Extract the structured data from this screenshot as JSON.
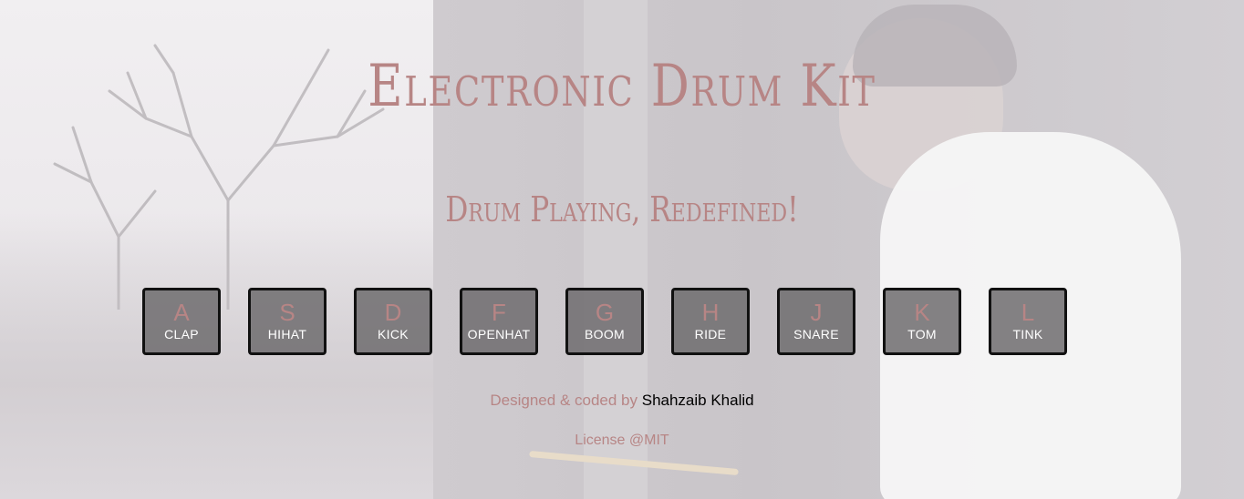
{
  "header": {
    "title": "Electronic Drum Kit",
    "subtitle": "Drum Playing, Redefined!"
  },
  "keys": [
    {
      "letter": "A",
      "sound": "CLAP"
    },
    {
      "letter": "S",
      "sound": "HIHAT"
    },
    {
      "letter": "D",
      "sound": "KICK"
    },
    {
      "letter": "F",
      "sound": "OPENHAT"
    },
    {
      "letter": "G",
      "sound": "BOOM"
    },
    {
      "letter": "H",
      "sound": "RIDE"
    },
    {
      "letter": "J",
      "sound": "SNARE"
    },
    {
      "letter": "K",
      "sound": "TOM"
    },
    {
      "letter": "L",
      "sound": "TINK"
    }
  ],
  "footer": {
    "credit_prefix": "Designed & coded by",
    "author_link": "Shahzaib Khalid",
    "license": "License @MIT"
  },
  "colors": {
    "accent": "#b78585",
    "key_border": "#111111",
    "key_bg": "#6e6c6e",
    "key_label": "#ffffff"
  }
}
